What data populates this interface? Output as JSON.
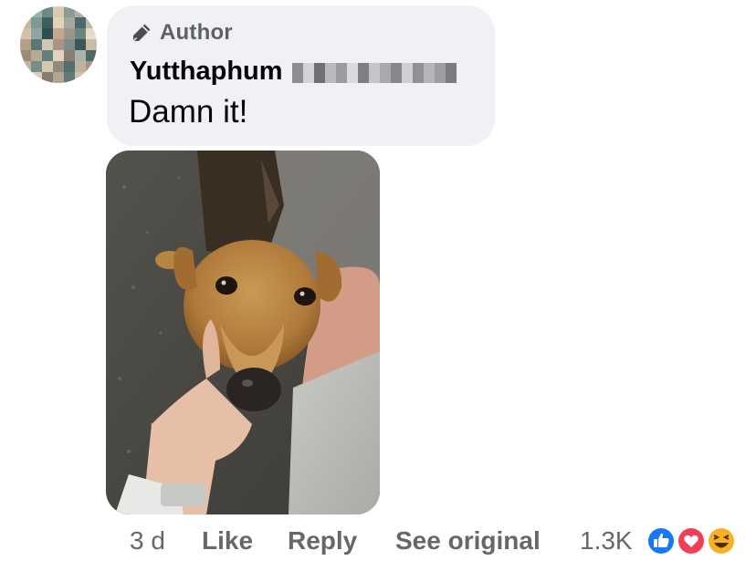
{
  "comment": {
    "author_badge": "Author",
    "user_name": "Yutthaphum",
    "text": "Damn it!"
  },
  "actions": {
    "time": "3 d",
    "like_label": "Like",
    "reply_label": "Reply",
    "see_original_label": "See original",
    "reaction_count": "1.3K"
  },
  "icons": {
    "author_badge_icon": "pen-icon",
    "reactions": [
      "like-reaction-icon",
      "love-reaction-icon",
      "haha-reaction-icon"
    ]
  },
  "colors": {
    "bubble_bg": "#eff1f4",
    "secondary_text": "#65676b",
    "primary_text": "#050505",
    "like_blue": "#1877f2",
    "love_red": "#f33e58",
    "haha_yellow": "#f7b125"
  },
  "media": {
    "image_subject": "dog-photo"
  }
}
